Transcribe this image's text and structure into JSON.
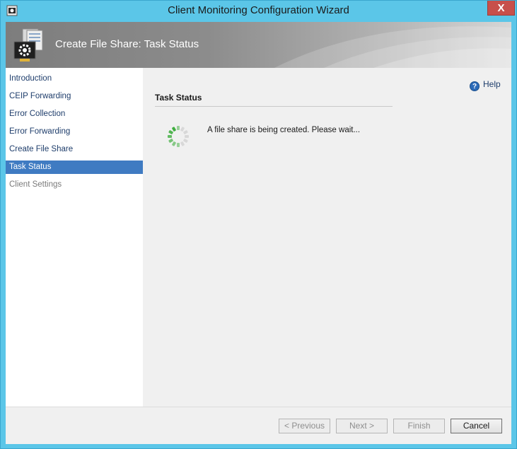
{
  "window": {
    "title": "Client Monitoring Configuration Wizard",
    "close_glyph": "X",
    "app_icon": "wizard-app-icon"
  },
  "banner": {
    "title": "Create File Share: Task Status",
    "icon": "server-gear-icon"
  },
  "nav": {
    "items": [
      {
        "label": "Introduction",
        "state": "done"
      },
      {
        "label": "CEIP Forwarding",
        "state": "done"
      },
      {
        "label": "Error Collection",
        "state": "done"
      },
      {
        "label": "Error Forwarding",
        "state": "done"
      },
      {
        "label": "Create File Share",
        "state": "done"
      },
      {
        "label": "Task Status",
        "state": "active"
      },
      {
        "label": "Client Settings",
        "state": "disabled"
      }
    ]
  },
  "content": {
    "help_label": "Help",
    "help_glyph": "?",
    "section_title": "Task Status",
    "status_message": "A file share is being created. Please wait..."
  },
  "footer": {
    "previous_label": "< Previous",
    "next_label": "Next >",
    "finish_label": "Finish",
    "cancel_label": "Cancel"
  },
  "colors": {
    "titlebar": "#5bc6e8",
    "nav_active": "#3f7bc2",
    "close_button": "#c7504b",
    "spinner_active": "#3fae3f"
  }
}
